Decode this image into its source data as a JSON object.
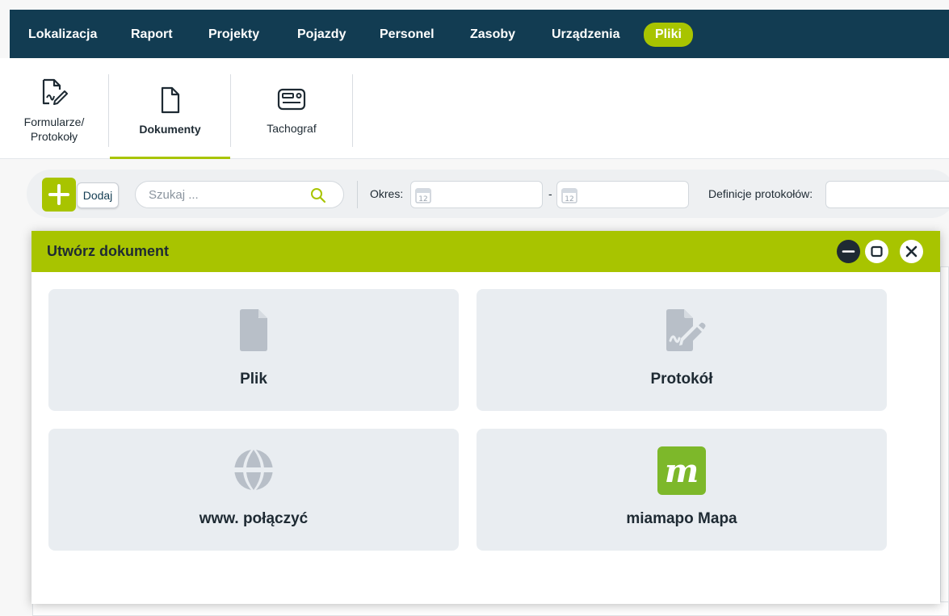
{
  "nav": {
    "items": [
      "Lokalizacja",
      "Raport",
      "Projekty",
      "Pojazdy",
      "Personel",
      "Zasoby",
      "Urządzenia",
      "Pliki"
    ],
    "active": "Pliki"
  },
  "subtabs": {
    "forms_line1": "Formularze/",
    "forms_line2": "Protokoły",
    "documents": "Dokumenty",
    "tachograph": "Tachograf"
  },
  "toolbar": {
    "add_label": "Dodaj",
    "search_placeholder": "Szukaj ...",
    "period_label": "Okres:",
    "period_separator": "-",
    "protocol_defs_label": "Definicje protokołów:",
    "calendar_day": "12"
  },
  "dialog": {
    "title": "Utwórz dokument",
    "options": [
      {
        "label": "Plik",
        "icon": "file-icon"
      },
      {
        "label": "Protokół",
        "icon": "file-signature-icon"
      },
      {
        "label": "www. połączyć",
        "icon": "globe-icon"
      },
      {
        "label": "miamapo Mapa",
        "icon": "miamapo-logo"
      }
    ],
    "logo_letter": "m"
  },
  "colors": {
    "nav_bg": "#123c52",
    "accent": "#a8c400",
    "card_bg": "#e9edf1",
    "icon_gray": "#b8bfc8",
    "miamapo_green": "#7db82a"
  }
}
